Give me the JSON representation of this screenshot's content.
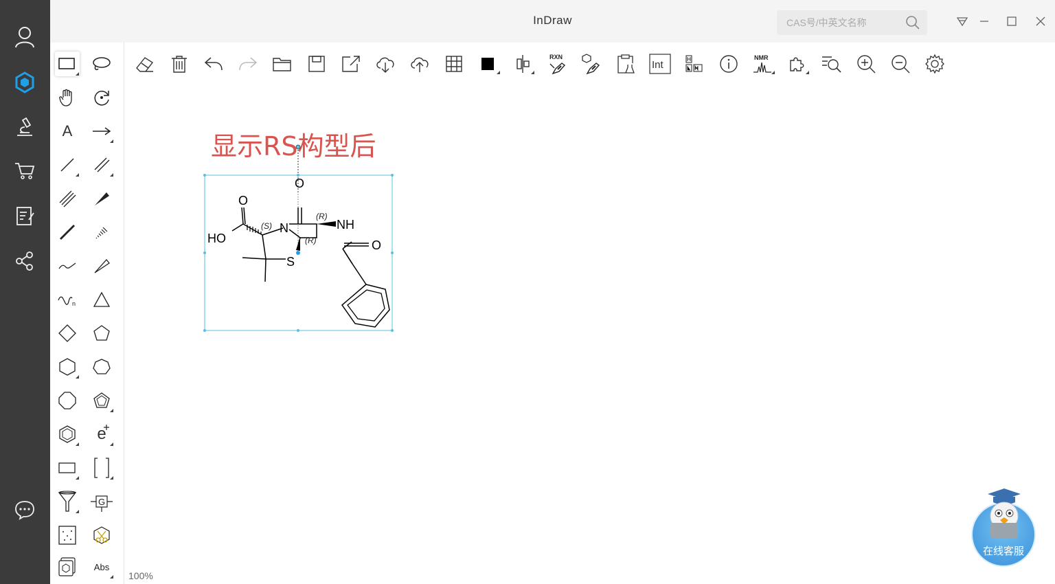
{
  "app": {
    "title": "InDraw"
  },
  "search": {
    "placeholder": "CAS号/中英文名称"
  },
  "canvas": {
    "caption": "显示RS构型后",
    "zoom": "100%"
  },
  "molecule": {
    "atoms": [
      "O",
      "O",
      "HO",
      "N",
      "NH",
      "O",
      "S"
    ],
    "stereo_labels": [
      "(S)",
      "(R)",
      "(R)"
    ]
  },
  "tool_palette": {
    "charge_symbol": "e",
    "template_label": "G",
    "abs_label": "Abs",
    "text_tool_label": "A"
  },
  "toolbar": {
    "rxn_label": "RXN",
    "int_label": "Int",
    "nmr_label": "NMR"
  },
  "online_service": {
    "label": "在线客服"
  },
  "colors": {
    "caption": "#d9534f",
    "selection": "#5bc0de",
    "rail": "#3b3b3b",
    "accent_icon": "#1e9fe6"
  }
}
